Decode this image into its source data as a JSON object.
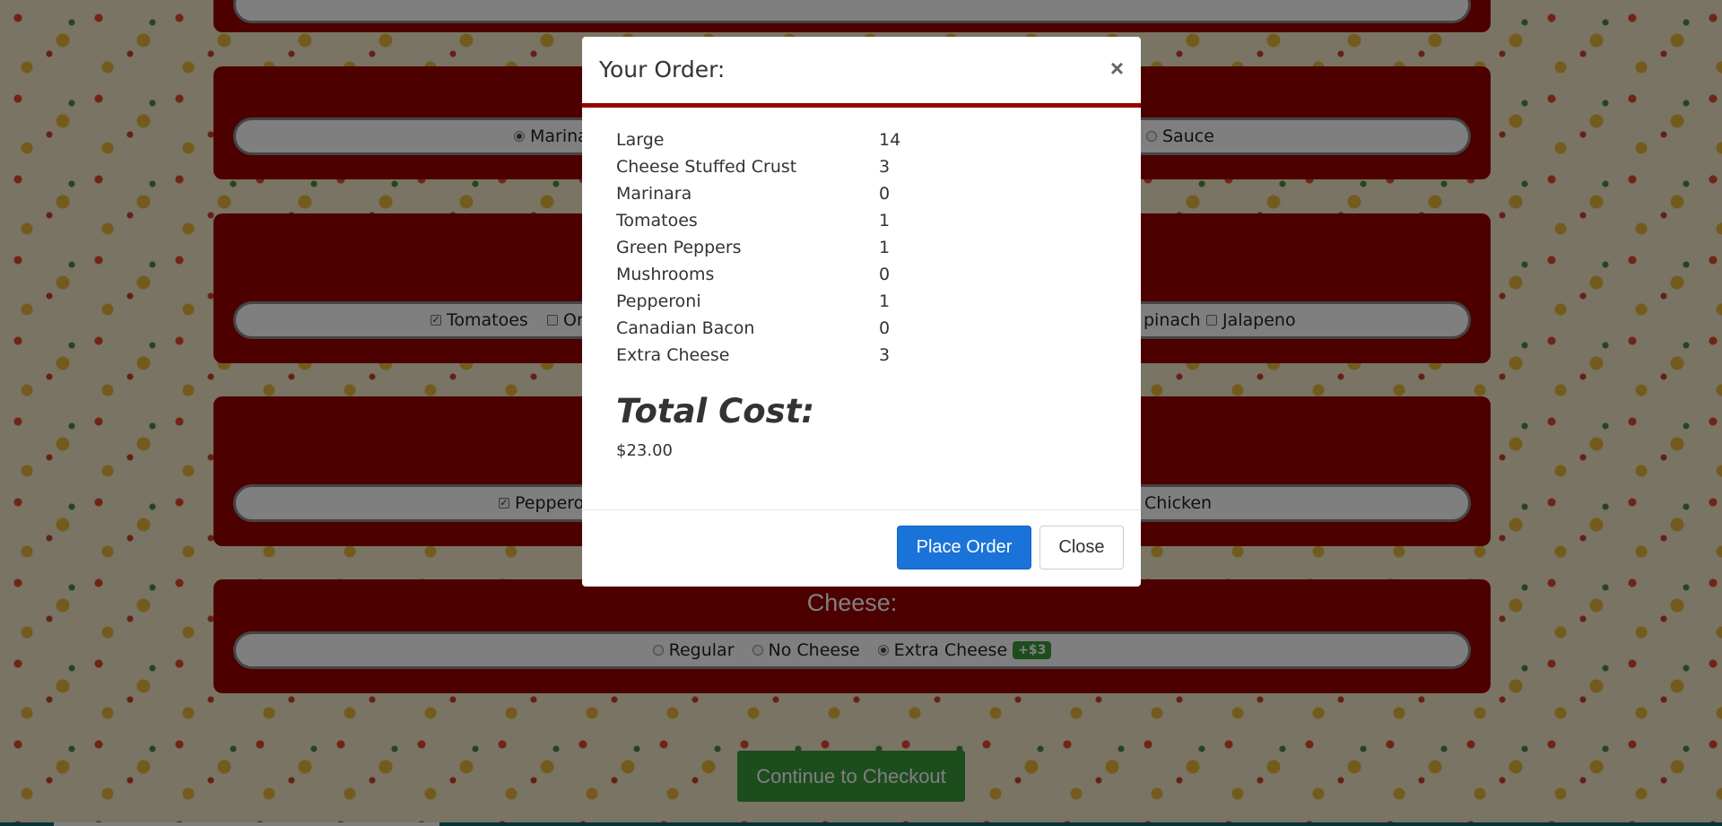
{
  "background": {
    "sauce_options": [
      {
        "label": "Marinara",
        "checked": true
      },
      {
        "label": "Sauce",
        "checked": false
      }
    ],
    "veggie_options": [
      {
        "label": "Tomatoes",
        "checked": true
      },
      {
        "label": "Onio",
        "checked": false
      },
      {
        "label": "pinach",
        "checked": false
      },
      {
        "label": "Jalapeno",
        "checked": false
      }
    ],
    "meat_options": [
      {
        "label": "Peppero",
        "checked": true
      },
      {
        "label": "Chicken",
        "checked": false
      }
    ],
    "cheese": {
      "title": "Cheese:",
      "options": [
        {
          "label": "Regular",
          "checked": false
        },
        {
          "label": "No Cheese",
          "checked": false
        },
        {
          "label": "Extra Cheese",
          "checked": true,
          "badge": "+$3"
        }
      ]
    },
    "checkout_label": "Continue to Checkout"
  },
  "modal": {
    "title": "Your Order:",
    "close_symbol": "×",
    "items": [
      {
        "name": "Large",
        "value": "14"
      },
      {
        "name": "Cheese Stuffed Crust",
        "value": "3"
      },
      {
        "name": "Marinara",
        "value": "0"
      },
      {
        "name": "Tomatoes",
        "value": "1"
      },
      {
        "name": "Green Peppers",
        "value": "1"
      },
      {
        "name": "Mushrooms",
        "value": "0"
      },
      {
        "name": "Pepperoni",
        "value": "1"
      },
      {
        "name": "Canadian Bacon",
        "value": "0"
      },
      {
        "name": "Extra Cheese",
        "value": "3"
      }
    ],
    "total_label": "Total Cost:",
    "total_value": "$23.00",
    "place_order_label": "Place Order",
    "close_label": "Close"
  },
  "colors": {
    "panel": "#990000",
    "accent_green": "#3a9a3a",
    "primary_blue": "#1a73d9"
  }
}
